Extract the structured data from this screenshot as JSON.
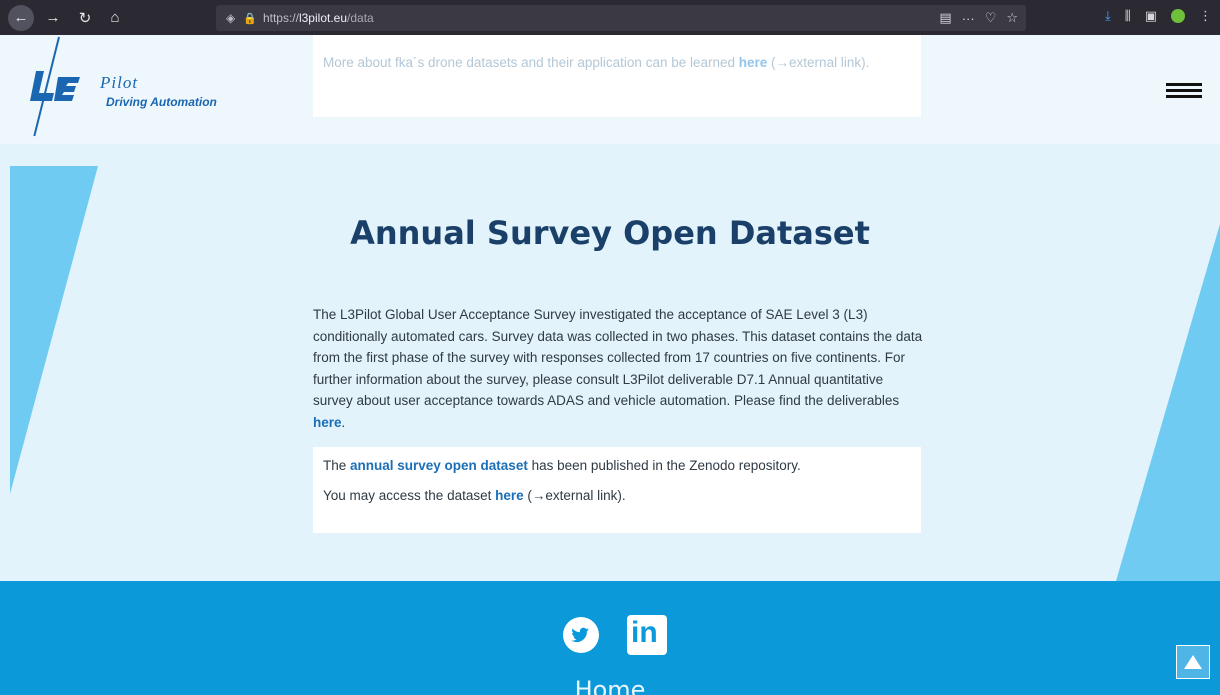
{
  "browser": {
    "url_scheme": "https://",
    "url_host": "l3pilot.eu",
    "url_path": "/data"
  },
  "header": {
    "logo_pilot": "Pilot",
    "logo_subtitle": "Driving Automation",
    "top_card_text": "More about fka´s drone datasets and their application can be learned ",
    "top_card_link": "here",
    "top_card_suffix": " (→external link)."
  },
  "section": {
    "title": "Annual Survey Open Dataset",
    "description": "The L3Pilot Global User Acceptance Survey investigated the acceptance of SAE Level 3 (L3) conditionally automated cars. Survey data was collected in two phases. This dataset contains the data from the first phase of the survey with responses collected from 17 countries on five continents. For further information about the survey, please consult L3Pilot deliverable D7.1 Annual quantitative survey about user acceptance towards ADAS and vehicle automation. Please find the deliverables ",
    "description_link": "here",
    "description_end": ".",
    "info_prefix": "The ",
    "info_link": "annual survey open dataset",
    "info_suffix": " has been published in the Zenodo repository.",
    "access_prefix": "You may access the dataset ",
    "access_link": "here",
    "access_suffix": " (→external link)."
  },
  "footer": {
    "linkedin": "in",
    "home": "Home"
  },
  "colors": {
    "accent": "#0b99da",
    "title": "#1a3f68",
    "link": "#1b6fb7"
  }
}
